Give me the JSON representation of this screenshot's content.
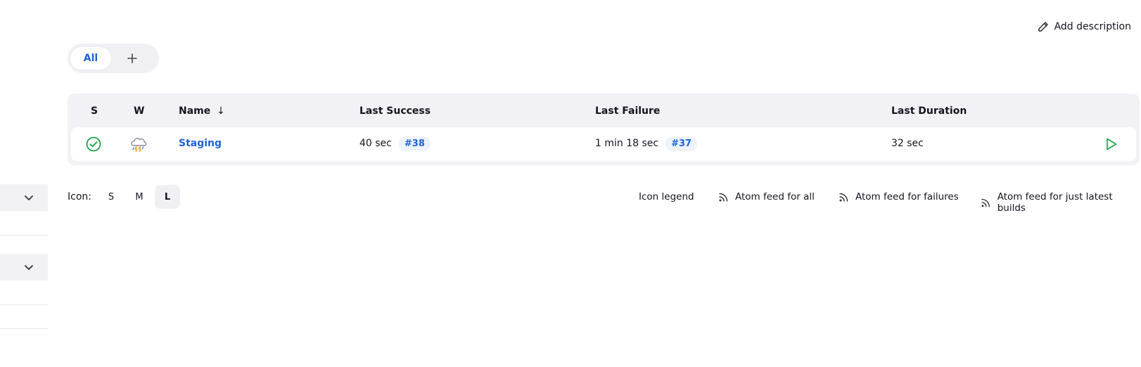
{
  "header": {
    "add_description": "Add description"
  },
  "tabs": [
    {
      "label": "All",
      "active": true
    },
    {
      "label": "+"
    }
  ],
  "table": {
    "columns": {
      "s": "S",
      "w": "W",
      "name": "Name",
      "sort_indicator": "↓",
      "last_success": "Last Success",
      "last_failure": "Last Failure",
      "last_duration": "Last Duration"
    },
    "rows": [
      {
        "status": "success",
        "weather": "thunderstorm",
        "name": "Staging",
        "last_success": "40 sec",
        "last_success_build": "#38",
        "last_failure": "1 min 18 sec",
        "last_failure_build": "#37",
        "last_duration": "32 sec"
      }
    ]
  },
  "icon_size": {
    "label": "Icon:",
    "options": [
      "S",
      "M",
      "L"
    ],
    "selected": "L"
  },
  "footer": {
    "icon_legend": "Icon legend",
    "feed_all": "Atom feed for all",
    "feed_failures": "Atom feed for failures",
    "feed_latest": "Atom feed for just latest builds"
  },
  "colors": {
    "accent": "#1d64d6",
    "success": "#1ea446",
    "panel": "#f2f2f6"
  }
}
